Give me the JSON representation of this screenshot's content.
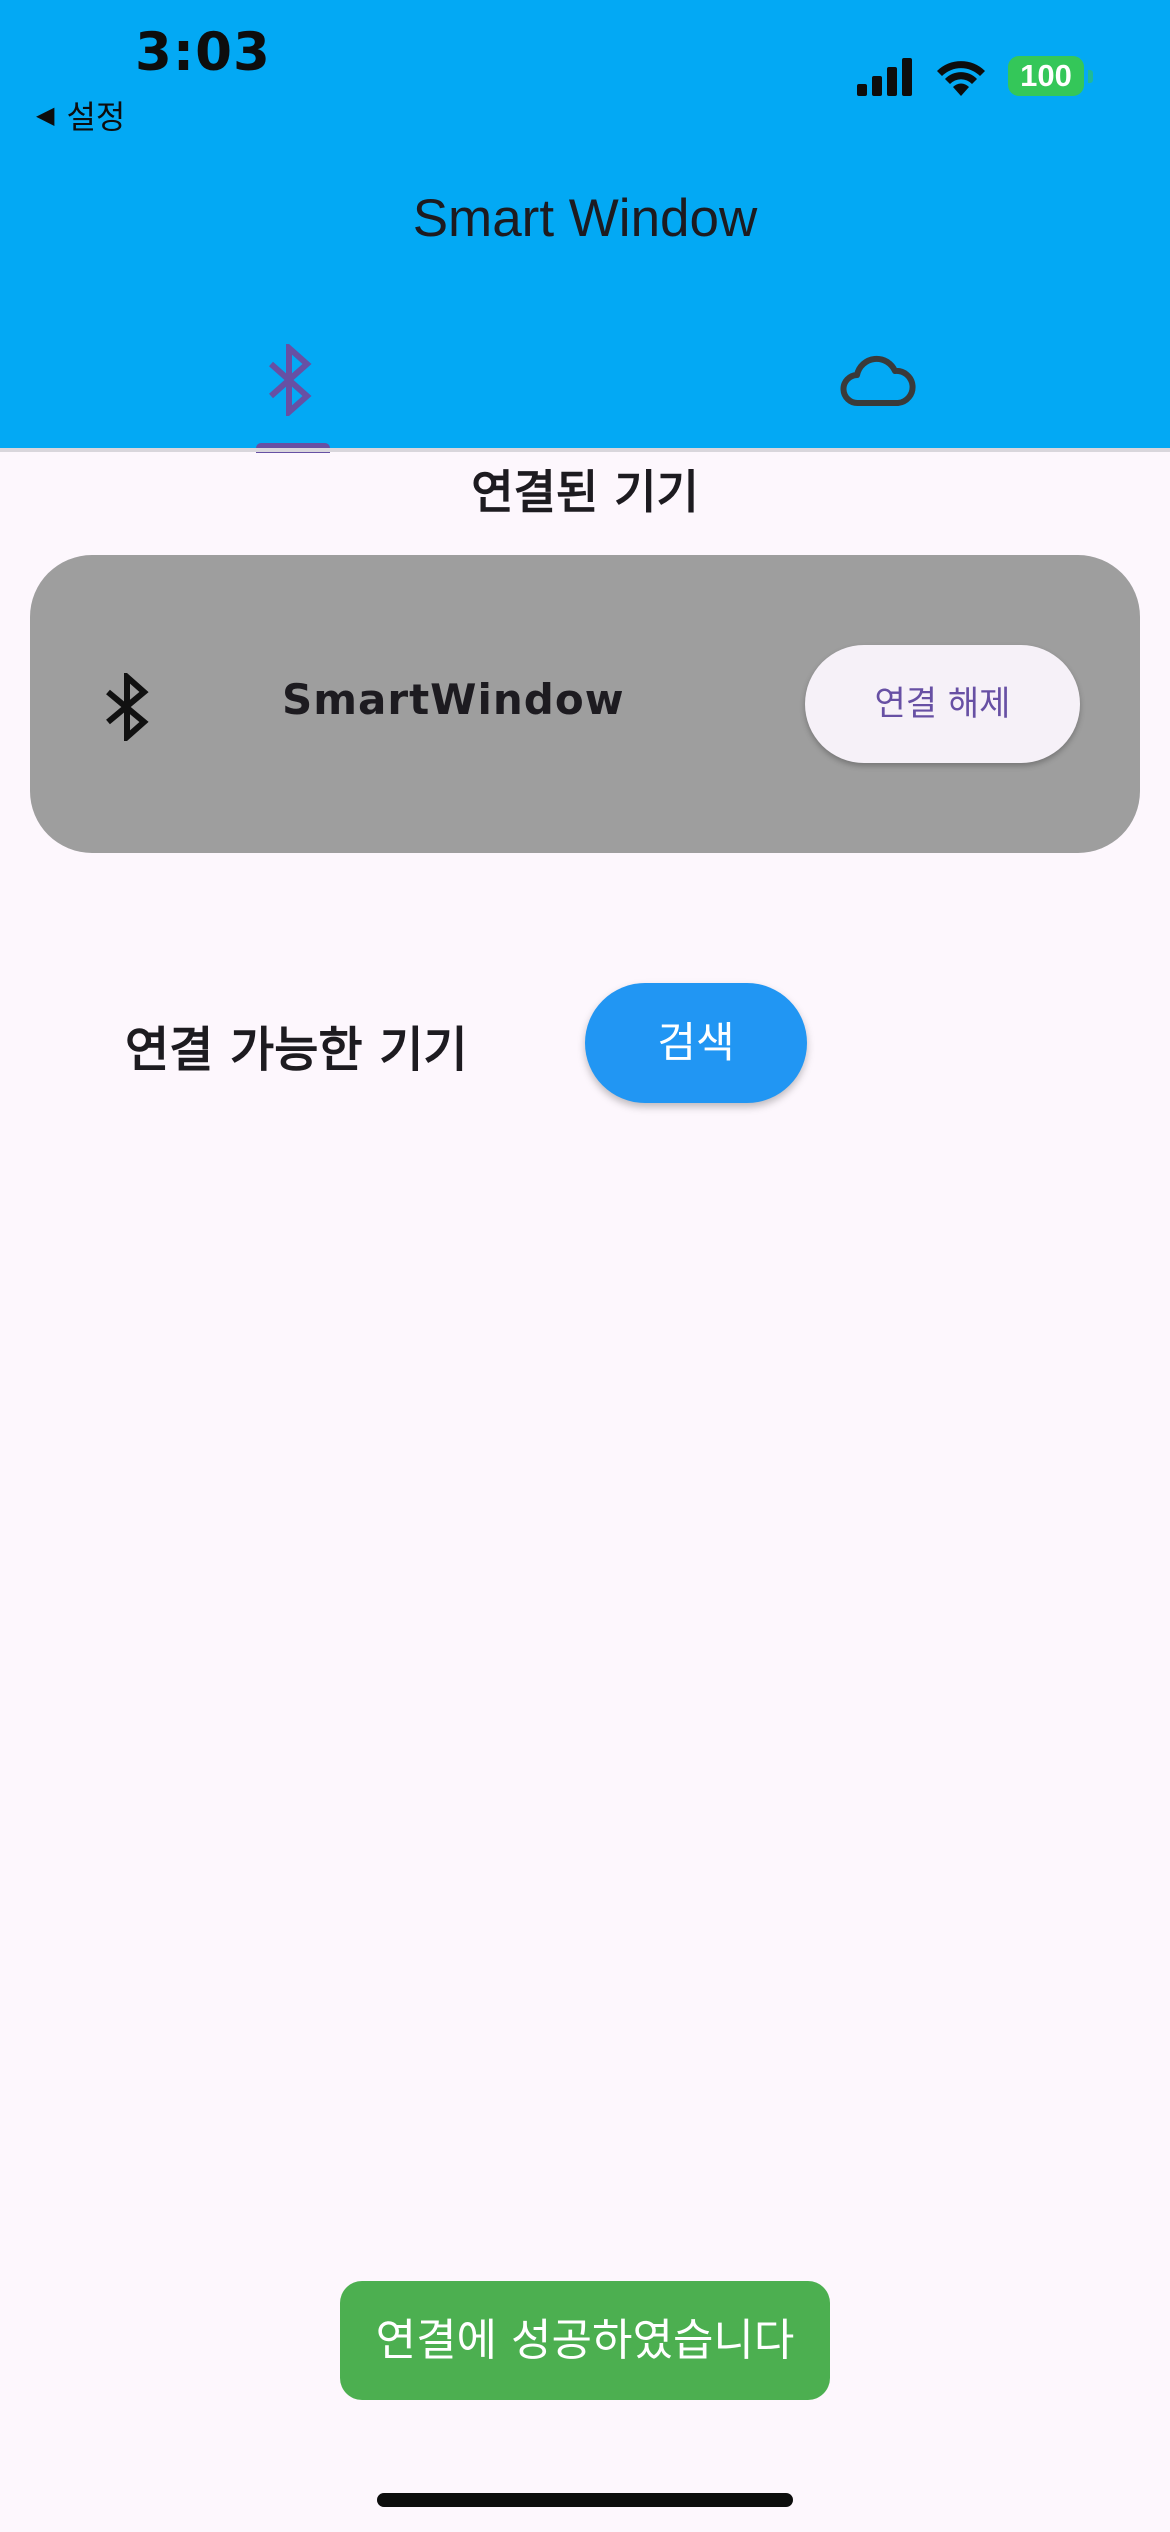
{
  "status_bar": {
    "time": "3:03",
    "back_label": "설정",
    "battery": "100",
    "icons": [
      "cellular-signal-icon",
      "wifi-icon",
      "battery-icon"
    ]
  },
  "app_bar": {
    "title": "Smart Window",
    "tabs": [
      {
        "icon": "bluetooth-icon",
        "selected": true
      },
      {
        "icon": "cloud-icon",
        "selected": false
      }
    ]
  },
  "connected": {
    "title": "연결된 기기",
    "device_name": "SmartWindow",
    "device_icon": "bluetooth-icon",
    "disconnect_label": "연결 해제"
  },
  "available": {
    "label": "연결 가능한 기기",
    "search_label": "검색"
  },
  "toast": {
    "message": "연결에 성공하였습니다"
  },
  "colors": {
    "app_bar": "#03a9f4",
    "background": "#fdf7fd",
    "card": "#9e9e9e",
    "accent": "#6750a4",
    "search_button": "#2196f3",
    "toast": "#4caf50",
    "battery": "#34c759"
  }
}
